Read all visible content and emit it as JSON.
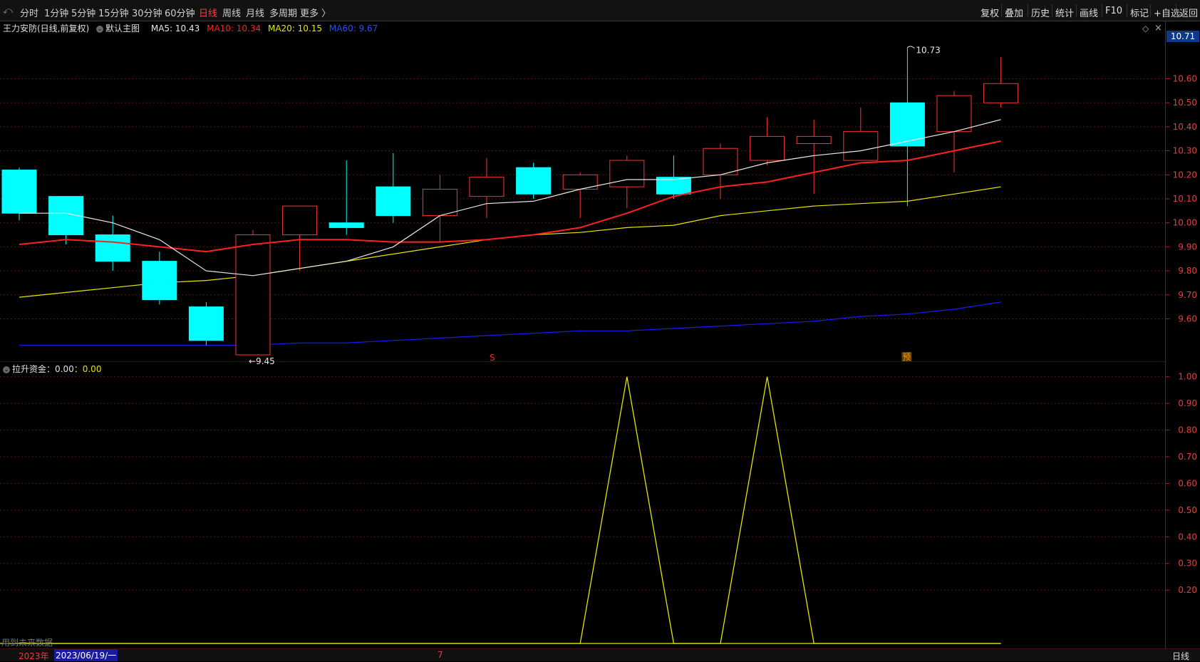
{
  "toolbar": {
    "periods": [
      "分时",
      "1分钟",
      "5分钟",
      "15分钟",
      "30分钟",
      "60分钟",
      "日线",
      "周线",
      "月线",
      "多周期",
      "更多 〉"
    ],
    "active_period": "日线",
    "actions": [
      "复权",
      "叠加",
      "历史",
      "统计",
      "画线",
      "F10",
      "标记",
      "+自选",
      "返回"
    ]
  },
  "legend": {
    "stock": "王力安防(日线,前复权)",
    "main_chart": "默认主图",
    "ma5": "MA5: 10.43",
    "ma10": "MA10: 10.34",
    "ma20": "MA20: 10.15",
    "ma60": "MA60: 9.67"
  },
  "indicator": {
    "label": "拉升资金：0.00",
    "value": "：0.00"
  },
  "markers": {
    "high": "10.73",
    "low": "←9.45",
    "s_mark": "S",
    "pre_mark": "预"
  },
  "price_badge": "10.71",
  "price_axis": [
    "10.60",
    "10.50",
    "10.40",
    "10.30",
    "10.20",
    "10.10",
    "10.00",
    "9.90",
    "9.80",
    "9.70",
    "9.60"
  ],
  "indicator_axis": [
    "1.00",
    "0.90",
    "0.80",
    "0.70",
    "0.60",
    "0.50",
    "0.40",
    "0.30",
    "0.20"
  ],
  "footer": {
    "future_note": "用到未来数据",
    "year": "2023年",
    "date": "2023/06/19/一",
    "month_mark": "7",
    "period_label": "日线"
  },
  "colors": {
    "up": "#ff3030",
    "down": "#00ffff",
    "ma5": "#e8e8e8",
    "ma10": "#ff2020",
    "ma20": "#e6e600",
    "ma60": "#1a1aff",
    "indicator": "#e6e600"
  },
  "chart_data": {
    "type": "candlestick",
    "candles": [
      {
        "open": 10.22,
        "close": 10.04,
        "high": 10.23,
        "low": 10.01
      },
      {
        "open": 10.11,
        "close": 9.95,
        "high": 10.11,
        "low": 9.91
      },
      {
        "open": 9.95,
        "close": 9.84,
        "high": 10.03,
        "low": 9.8
      },
      {
        "open": 9.84,
        "close": 9.68,
        "high": 9.88,
        "low": 9.66
      },
      {
        "open": 9.65,
        "close": 9.51,
        "high": 9.67,
        "low": 9.49
      },
      {
        "open": 9.45,
        "close": 9.95,
        "high": 9.97,
        "low": 9.45
      },
      {
        "open": 9.95,
        "close": 10.07,
        "high": 10.07,
        "low": 9.8
      },
      {
        "open": 10.0,
        "close": 9.98,
        "high": 10.26,
        "low": 9.95
      },
      {
        "open": 10.15,
        "close": 10.03,
        "high": 10.29,
        "low": 10.0
      },
      {
        "open": 10.03,
        "close": 10.14,
        "high": 10.2,
        "low": 9.92
      },
      {
        "open": 10.11,
        "close": 10.19,
        "high": 10.27,
        "low": 10.02
      },
      {
        "open": 10.23,
        "close": 10.12,
        "high": 10.25,
        "low": 10.1
      },
      {
        "open": 10.14,
        "close": 10.2,
        "high": 10.21,
        "low": 10.02
      },
      {
        "open": 10.15,
        "close": 10.26,
        "high": 10.28,
        "low": 10.06
      },
      {
        "open": 10.19,
        "close": 10.12,
        "high": 10.28,
        "low": 10.1
      },
      {
        "open": 10.2,
        "close": 10.31,
        "high": 10.33,
        "low": 10.1
      },
      {
        "open": 10.26,
        "close": 10.36,
        "high": 10.44,
        "low": 10.24
      },
      {
        "open": 10.33,
        "close": 10.36,
        "high": 10.43,
        "low": 10.12
      },
      {
        "open": 10.26,
        "close": 10.38,
        "high": 10.48,
        "low": 10.26
      },
      {
        "open": 10.5,
        "close": 10.32,
        "high": 10.73,
        "low": 10.07
      },
      {
        "open": 10.38,
        "close": 10.53,
        "high": 10.55,
        "low": 10.21
      },
      {
        "open": 10.5,
        "close": 10.58,
        "high": 10.69,
        "low": 10.48
      }
    ],
    "ma5": [
      10.04,
      10.04,
      10.0,
      9.93,
      9.8,
      9.78,
      9.81,
      9.84,
      9.9,
      10.03,
      10.08,
      10.09,
      10.14,
      10.18,
      10.18,
      10.2,
      10.25,
      10.28,
      10.3,
      10.34,
      10.38,
      10.43
    ],
    "ma10": [
      9.91,
      9.93,
      9.92,
      9.9,
      9.88,
      9.91,
      9.93,
      9.93,
      9.92,
      9.92,
      9.93,
      9.95,
      9.98,
      10.04,
      10.11,
      10.15,
      10.17,
      10.21,
      10.25,
      10.26,
      10.3,
      10.34
    ],
    "ma20": [
      9.69,
      9.71,
      9.73,
      9.75,
      9.76,
      9.78,
      9.81,
      9.84,
      9.87,
      9.9,
      9.93,
      9.95,
      9.96,
      9.98,
      9.99,
      10.03,
      10.05,
      10.07,
      10.08,
      10.09,
      10.12,
      10.15
    ],
    "ma60": [
      9.49,
      9.49,
      9.49,
      9.49,
      9.49,
      9.49,
      9.5,
      9.5,
      9.51,
      9.52,
      9.53,
      9.54,
      9.55,
      9.55,
      9.56,
      9.57,
      9.58,
      9.59,
      9.61,
      9.62,
      9.64,
      9.67
    ],
    "indicator_values": [
      0,
      0,
      0,
      0,
      0,
      0,
      0,
      0,
      0,
      0,
      0,
      0,
      0,
      1,
      0,
      0,
      1,
      0,
      0,
      0,
      0,
      0
    ],
    "price_ylim": [
      9.45,
      10.75
    ],
    "indicator_ylim": [
      0,
      1.05
    ]
  }
}
